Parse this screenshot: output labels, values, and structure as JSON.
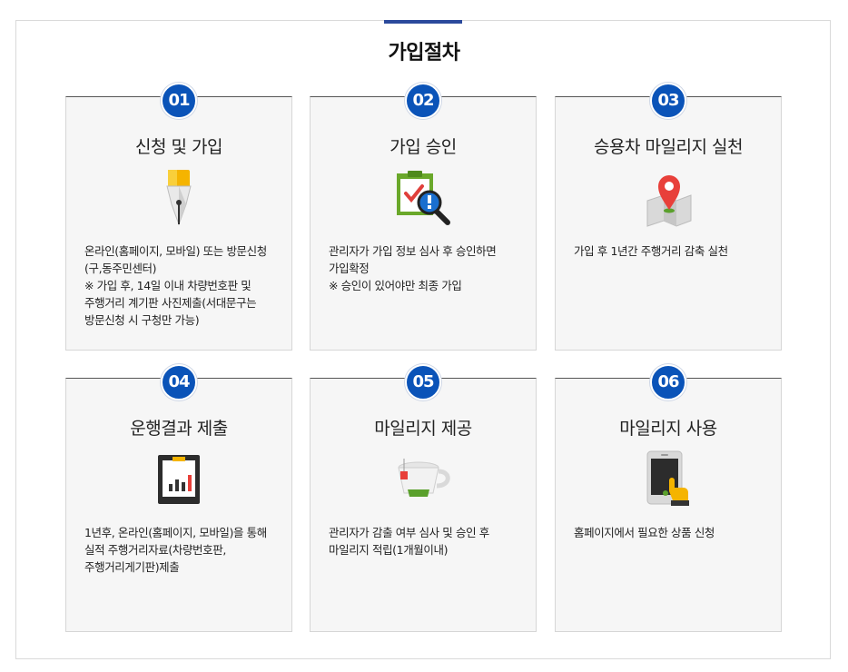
{
  "page": {
    "title": "가입절차",
    "accent_color": "#0a53b8"
  },
  "steps": [
    {
      "number": "01",
      "title": "신청 및 가입",
      "icon": "fountain-pen-icon",
      "description": "온라인(홈페이지, 모바일) 또는 방문신청(구,동주민센터)\n※ 가입 후, 14일 이내 차량번호판 및 주행거리 계기판 사진제출(서대문구는 방문신청 시 구청만 가능)"
    },
    {
      "number": "02",
      "title": "가입 승인",
      "icon": "clipboard-magnifier-icon",
      "description": "관리자가 가입 정보 심사 후 승인하면 가입확정\n※ 승인이 있어야만 최종 가입"
    },
    {
      "number": "03",
      "title": "승용차 마일리지 실천",
      "icon": "map-pin-icon",
      "description": "가입 후 1년간 주행거리 감축 실천"
    },
    {
      "number": "04",
      "title": "운행결과 제출",
      "icon": "bar-chart-board-icon",
      "description": "1년후, 온라인(홈페이지, 모바일)을 통해 실적 주행거리자료(차량번호판, 주행거리게기판)제출"
    },
    {
      "number": "05",
      "title": "마일리지 제공",
      "icon": "coffee-cup-icon",
      "description": "관리자가 감출 여부 심사 및 승인 후 마일리지 적립(1개월이내)"
    },
    {
      "number": "06",
      "title": "마일리지 사용",
      "icon": "smartphone-tap-icon",
      "description": "홈페이지에서 필요한 상품 신청"
    }
  ]
}
